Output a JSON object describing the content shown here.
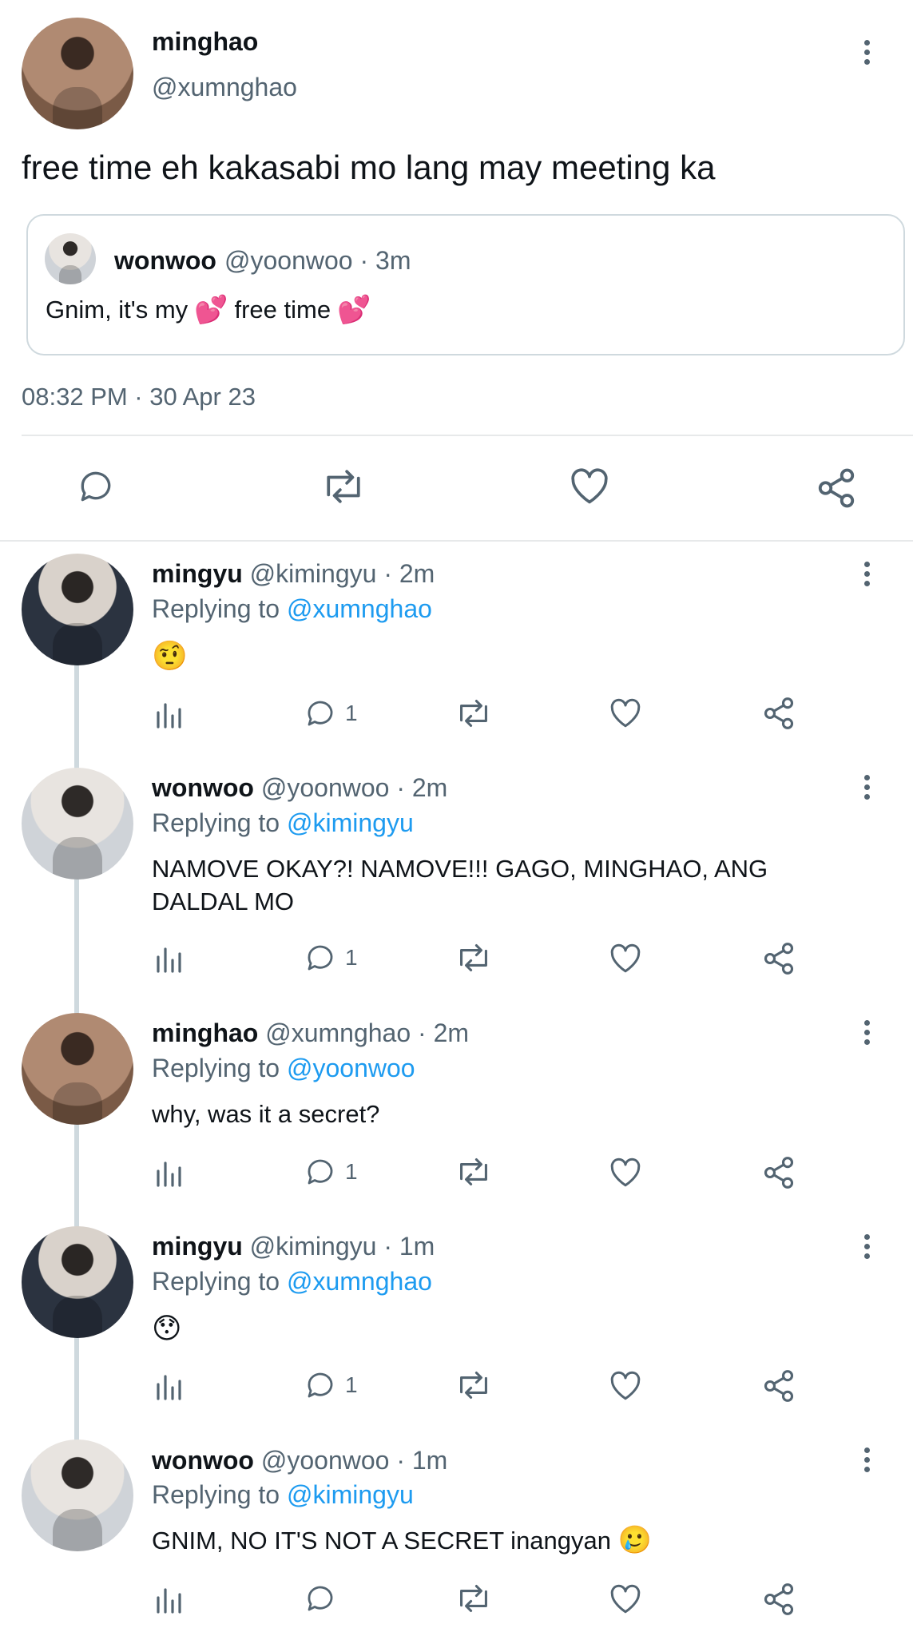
{
  "main_post": {
    "display_name": "minghao",
    "handle": "@xumnghao",
    "text": "free time eh kakasabi mo lang may meeting ka",
    "quoted": {
      "display_name": "wonwoo",
      "meta": "@yoonwoo · 3m",
      "text_part1": "Gnim, it's my",
      "text_part2": "free time",
      "emoji": "💕"
    },
    "timestamp": "08:32 PM · 30 Apr 23"
  },
  "replies": [
    {
      "display_name": "mingyu",
      "meta": "@kimingyu · 2m",
      "replying_prefix": "Replying to",
      "replying_to": "@xumnghao",
      "text": "",
      "emoji": "🤨",
      "reply_count": "1"
    },
    {
      "display_name": "wonwoo",
      "meta": "@yoonwoo · 2m",
      "replying_prefix": "Replying to",
      "replying_to": "@kimingyu",
      "text_line1": "NAMOVE OKAY?! NAMOVE!!! GAGO, MINGHAO, ANG",
      "text_line2": "DALDAL MO",
      "reply_count": "1"
    },
    {
      "display_name": "minghao",
      "meta": "@xumnghao · 2m",
      "replying_prefix": "Replying to",
      "replying_to": "@yoonwoo",
      "text": "why, was it a secret?",
      "reply_count": "1"
    },
    {
      "display_name": "mingyu",
      "meta": "@kimingyu · 1m",
      "replying_prefix": "Replying to",
      "replying_to": "@xumnghao",
      "emoji": "😯",
      "reply_count": "1"
    },
    {
      "display_name": "wonwoo",
      "meta": "@yoonwoo · 1m",
      "replying_prefix": "Replying to",
      "replying_to": "@kimingyu",
      "text": "GNIM, NO IT'S NOT A SECRET inangyan",
      "emoji": "🥲",
      "reply_count": ""
    }
  ],
  "colors": {
    "link": "#1d9bf0",
    "secondary": "#536471",
    "thread_line": "#cfd9de",
    "divider": "#e7e9ea"
  }
}
